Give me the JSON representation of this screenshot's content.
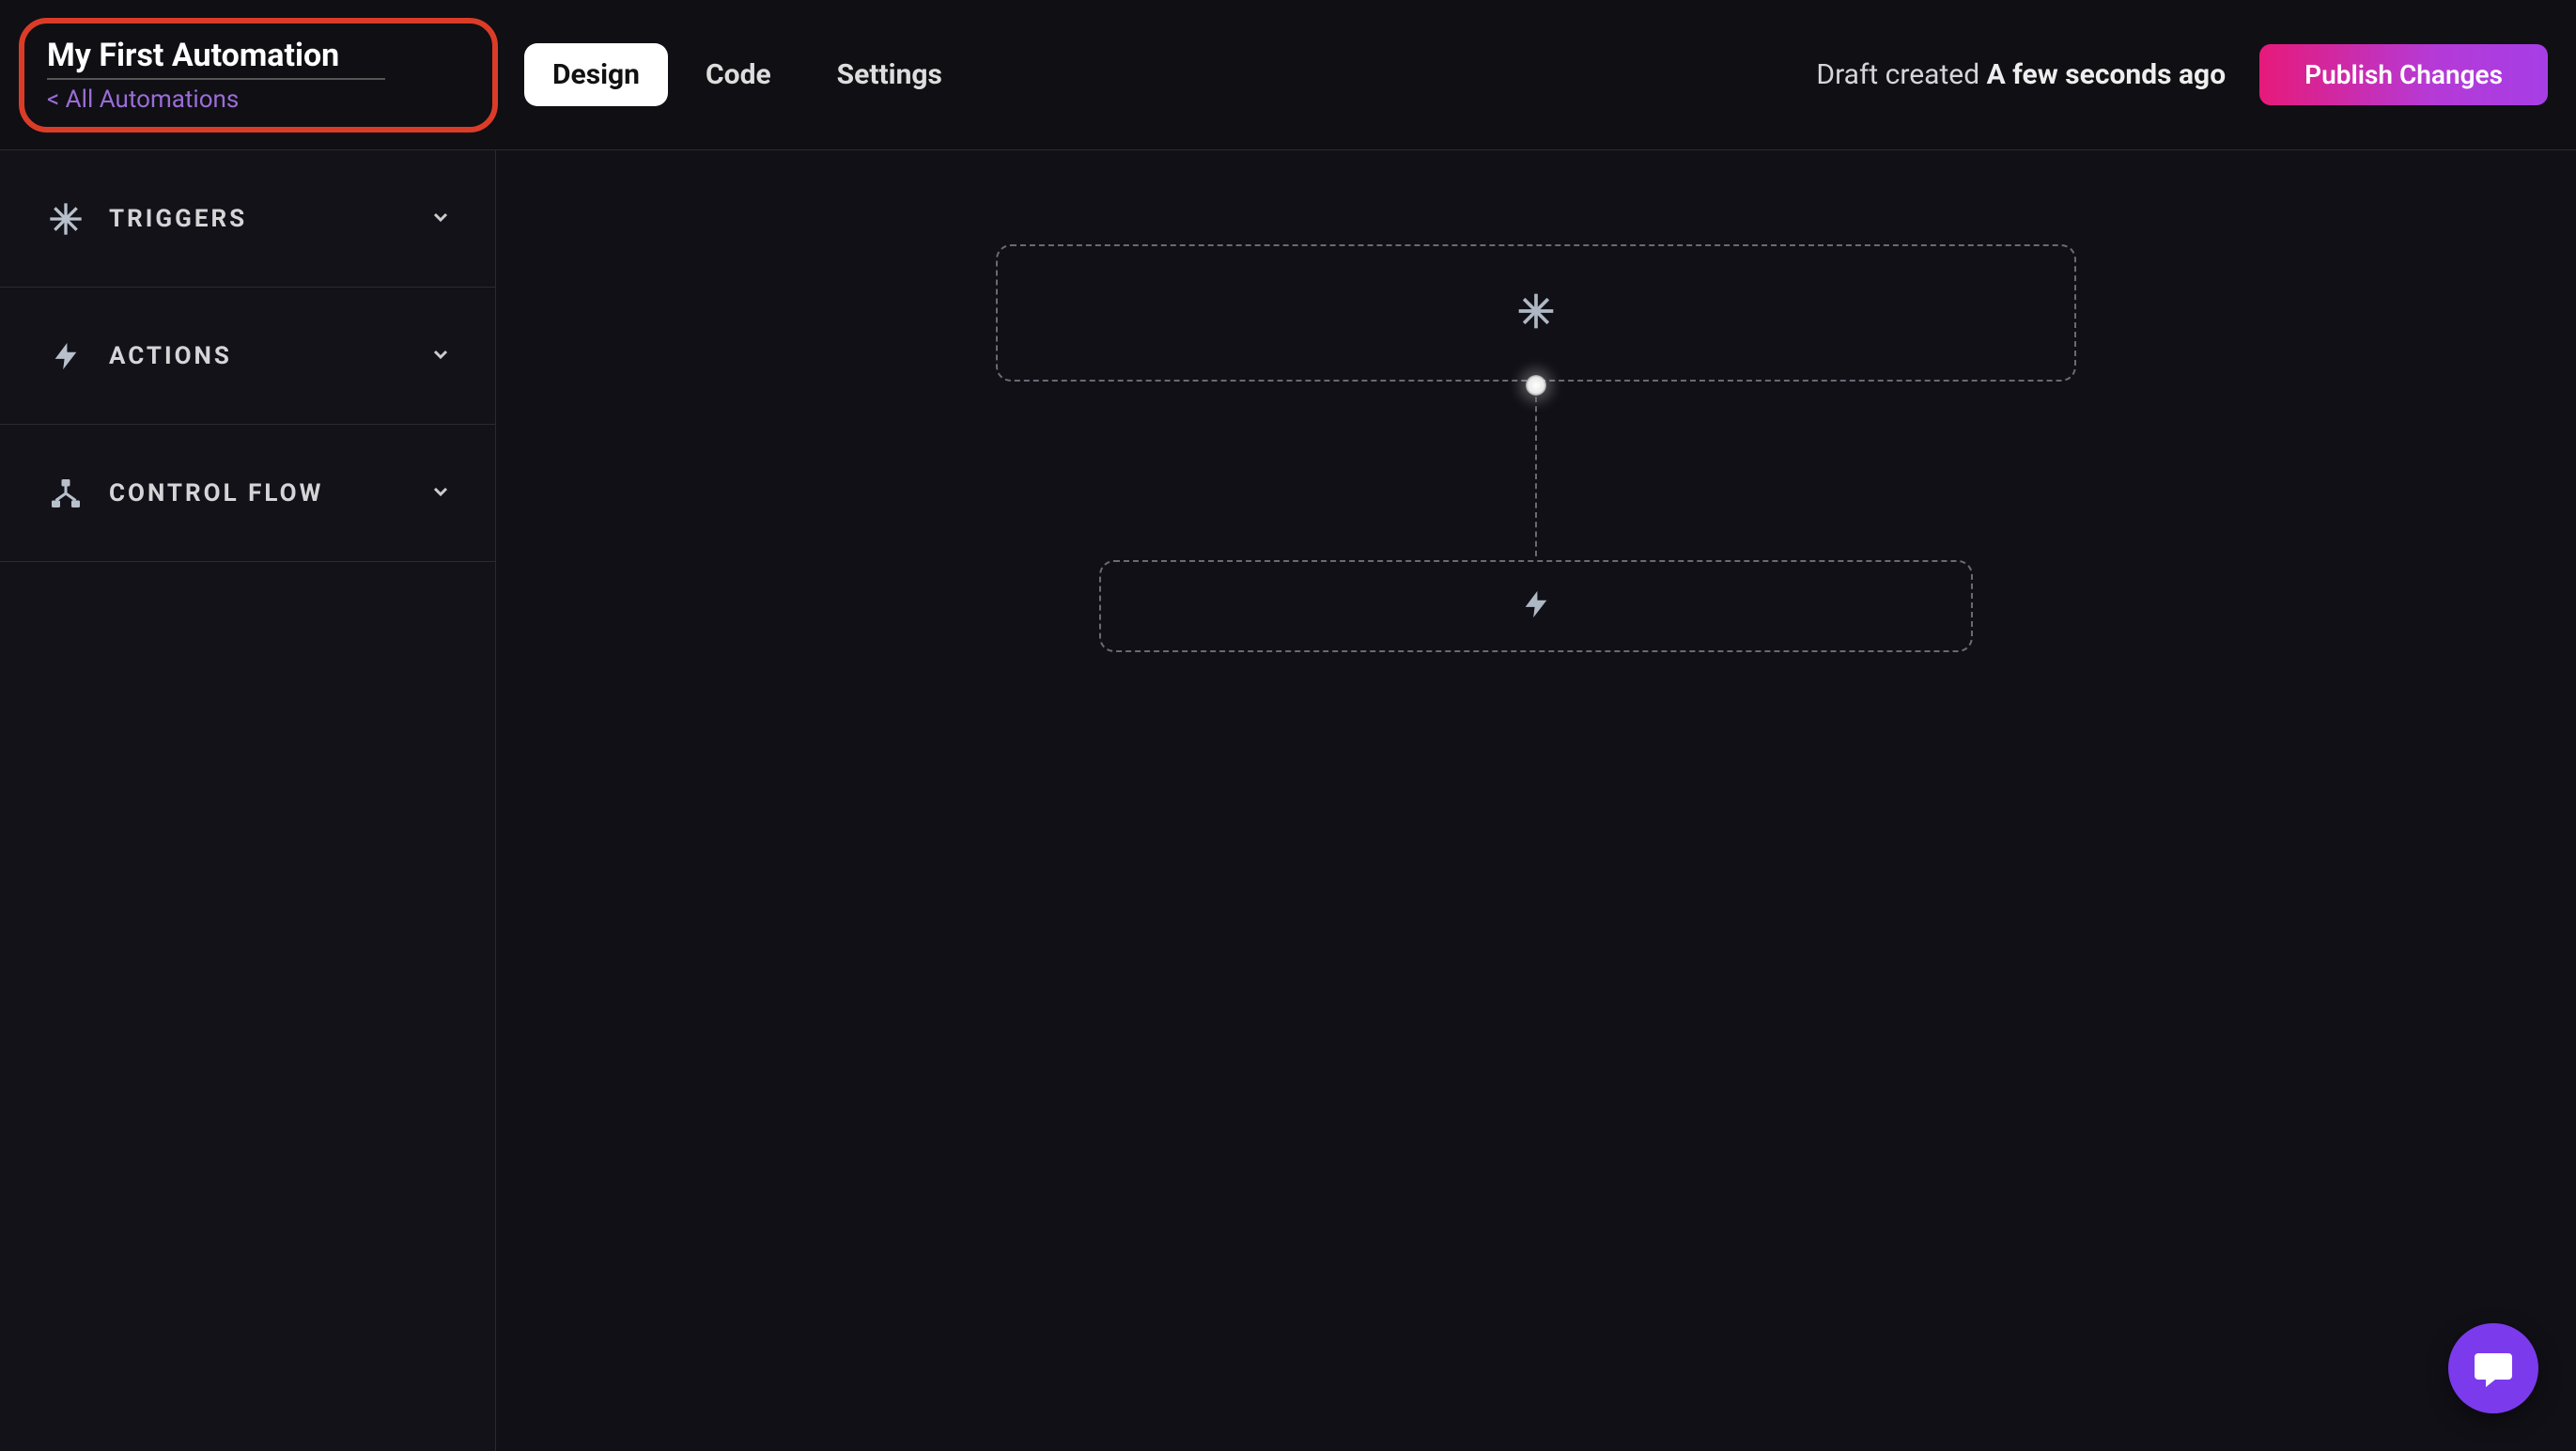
{
  "header": {
    "title_value": "My First Automation",
    "back_link_label": "< All Automations",
    "tabs": [
      {
        "label": "Design",
        "active": true
      },
      {
        "label": "Code",
        "active": false
      },
      {
        "label": "Settings",
        "active": false
      }
    ],
    "draft_status_prefix": "Draft created ",
    "draft_status_time": "A few seconds ago",
    "publish_label": "Publish Changes"
  },
  "sidebar": {
    "items": [
      {
        "label": "TRIGGERS",
        "icon": "spark-icon"
      },
      {
        "label": "ACTIONS",
        "icon": "bolt-icon"
      },
      {
        "label": "CONTROL FLOW",
        "icon": "flow-icon"
      }
    ]
  },
  "canvas": {
    "trigger_icon": "spark-icon",
    "action_icon": "bolt-icon"
  },
  "fab": {
    "icon": "chat-icon"
  }
}
